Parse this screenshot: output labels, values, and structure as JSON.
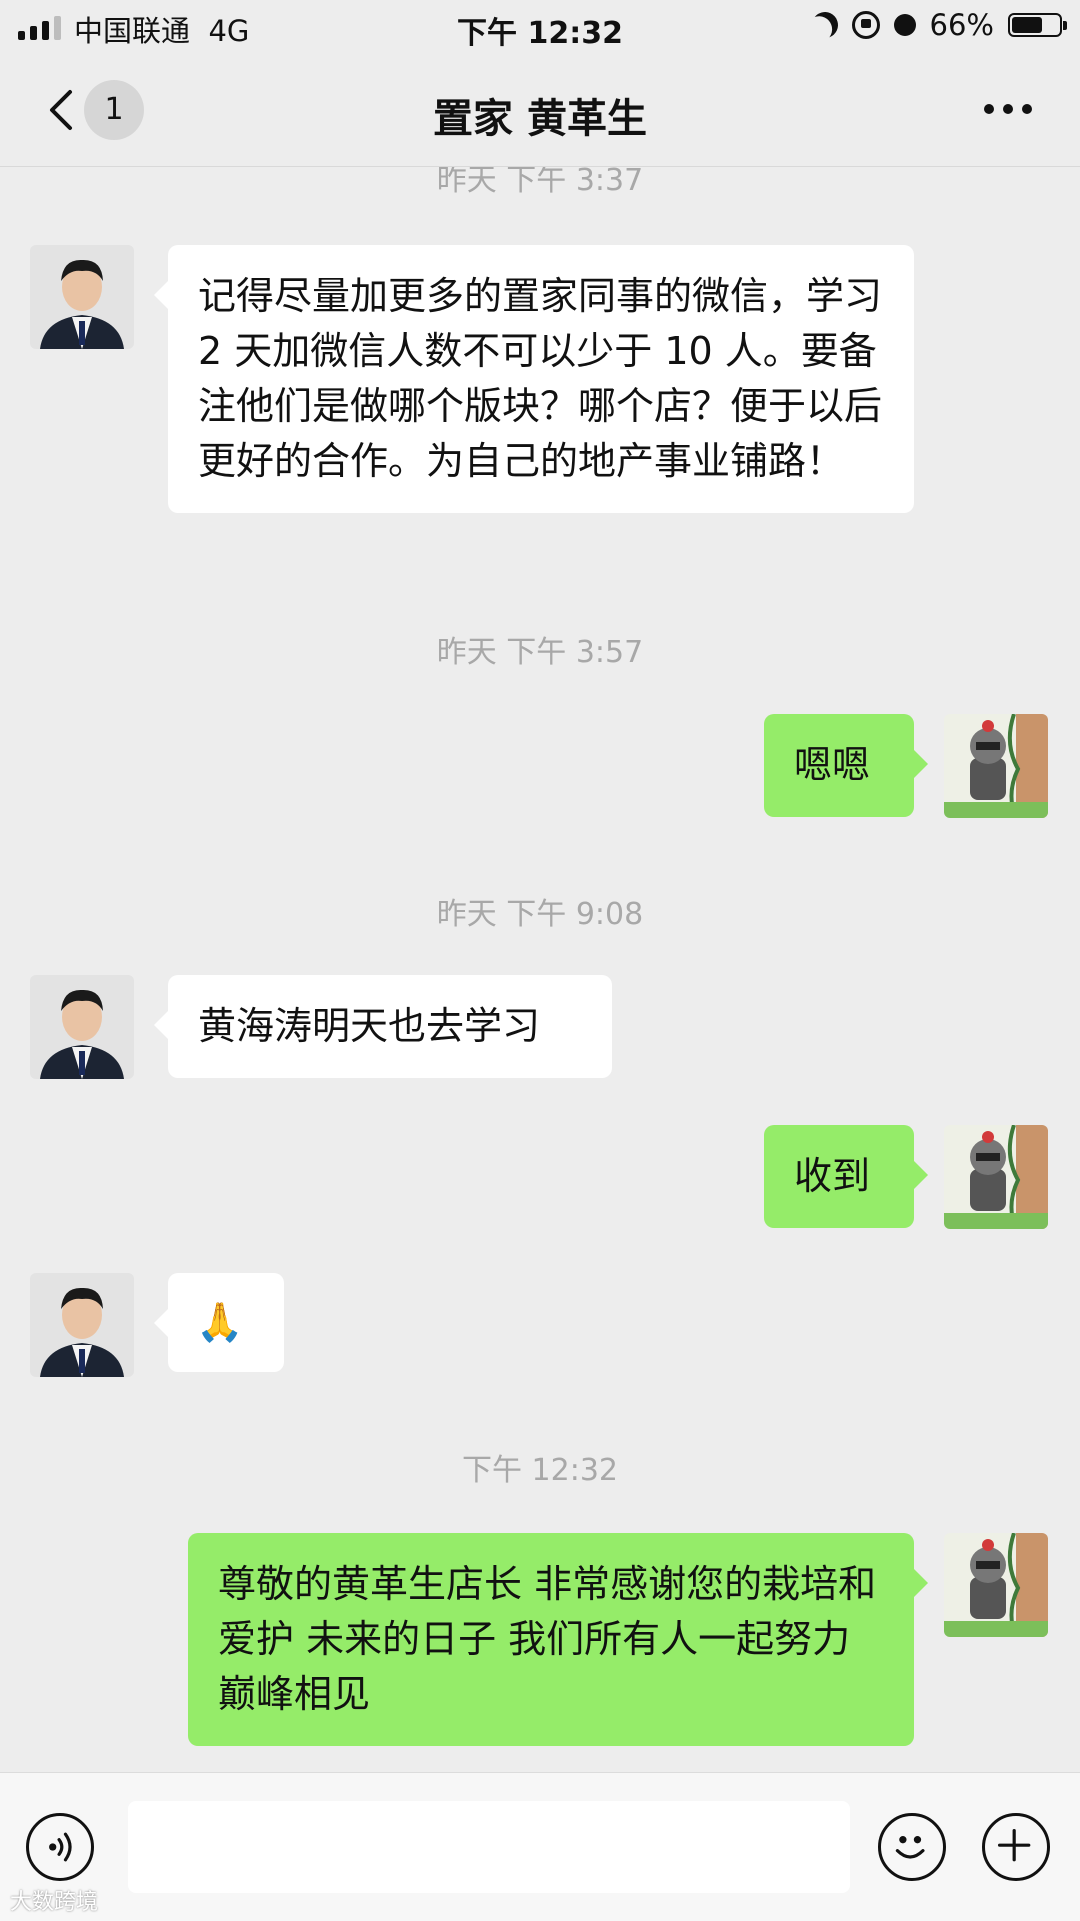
{
  "status_bar": {
    "carrier": "中国联通",
    "network": "4G",
    "time": "下午 12:32",
    "battery_percent": "66%",
    "battery_level": 0.66
  },
  "nav": {
    "unread_count": "1",
    "title": "置家 黄革生"
  },
  "messages": [
    {
      "type": "timestamp",
      "text": "昨天 下午 3:37"
    },
    {
      "type": "in",
      "text": "记得尽量加更多的置家同事的微信，学习 2 天加微信人数不可以少于 10 人。要备注他们是做哪个版块？哪个店？便于以后更好的合作。为自己的地产事业铺路！"
    },
    {
      "type": "timestamp",
      "text": "昨天 下午 3:57"
    },
    {
      "type": "out",
      "text": "嗯嗯"
    },
    {
      "type": "timestamp",
      "text": "昨天 下午 9:08"
    },
    {
      "type": "in",
      "text": "黄海涛明天也去学习"
    },
    {
      "type": "out",
      "text": "收到"
    },
    {
      "type": "in",
      "text": "🙏"
    },
    {
      "type": "timestamp",
      "text": "下午 12:32"
    },
    {
      "type": "out",
      "text": "尊敬的黄革生店长 非常感谢您的栽培和爱护 未来的日子 我们所有人一起努力 巅峰相见"
    }
  ],
  "watermark": "大数跨境",
  "icons": {
    "back": "chevron-left-icon",
    "more": "more-dots-icon",
    "voice": "voice-icon",
    "emoji": "emoji-icon",
    "plus": "plus-icon"
  },
  "colors": {
    "background": "#ededed",
    "outgoing_bubble": "#95ec69",
    "incoming_bubble": "#ffffff",
    "timestamp_text": "#a8a8a8"
  }
}
